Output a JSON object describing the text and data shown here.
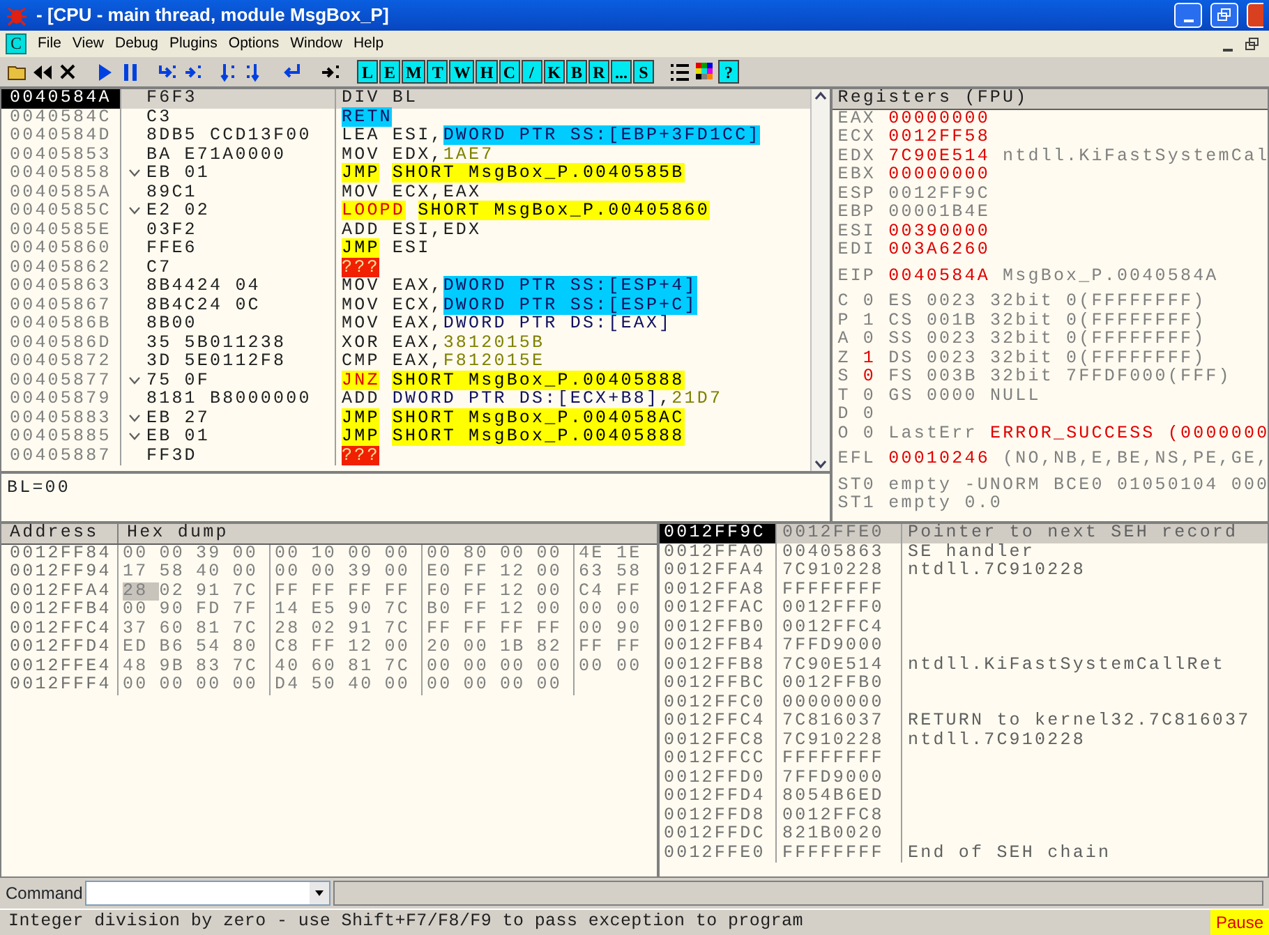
{
  "window": {
    "title": "- [CPU - main thread, module MsgBox_P]"
  },
  "menu": {
    "badge": "C",
    "items": [
      "File",
      "View",
      "Debug",
      "Plugins",
      "Options",
      "Window",
      "Help"
    ]
  },
  "toolbar": {
    "letters": [
      "L",
      "E",
      "M",
      "T",
      "W",
      "H",
      "C",
      "/",
      "K",
      "B",
      "R",
      "...",
      "S"
    ],
    "help": "?"
  },
  "disassembly": {
    "rows": [
      {
        "address": "0040584A",
        "jump": false,
        "hex": "F6F3",
        "mnemonic": {
          "text": "DIV",
          "kind": "op"
        },
        "operands": [
          {
            "text": "BL",
            "kind": "op"
          }
        ],
        "selected": true
      },
      {
        "address": "0040584C",
        "jump": false,
        "hex": "C3",
        "mnemonic": {
          "text": "RETN",
          "kind": "ret"
        },
        "operands": [],
        "selected": false
      },
      {
        "address": "0040584D",
        "jump": false,
        "hex": "8DB5 CCD13F00",
        "mnemonic": {
          "text": "LEA",
          "kind": "op"
        },
        "operands": [
          {
            "text": "ESI,",
            "kind": "op"
          },
          {
            "text": "DWORD PTR SS:[EBP+3FD1CC]",
            "kind": "mem"
          }
        ],
        "selected": false
      },
      {
        "address": "00405853",
        "jump": false,
        "hex": "BA E71A0000",
        "mnemonic": {
          "text": "MOV",
          "kind": "op"
        },
        "operands": [
          {
            "text": "EDX,",
            "kind": "op"
          },
          {
            "text": "1AE7",
            "kind": "imm"
          }
        ],
        "selected": false
      },
      {
        "address": "00405858",
        "jump": true,
        "hex": "EB 01",
        "mnemonic": {
          "text": "JMP",
          "kind": "jmp"
        },
        "operands": [
          {
            "text": "SHORT MsgBox_P.0040585B",
            "kind": "jmp"
          }
        ],
        "selected": false
      },
      {
        "address": "0040585A",
        "jump": false,
        "hex": "89C1",
        "mnemonic": {
          "text": "MOV",
          "kind": "op"
        },
        "operands": [
          {
            "text": "ECX,EAX",
            "kind": "op"
          }
        ],
        "selected": false
      },
      {
        "address": "0040585C",
        "jump": true,
        "hex": "E2 02",
        "mnemonic": {
          "text": "LOOPD",
          "kind": "jcc"
        },
        "operands": [
          {
            "text": "SHORT MsgBox_P.00405860",
            "kind": "jmp"
          }
        ],
        "selected": false
      },
      {
        "address": "0040585E",
        "jump": false,
        "hex": "03F2",
        "mnemonic": {
          "text": "ADD",
          "kind": "op"
        },
        "operands": [
          {
            "text": "ESI,EDX",
            "kind": "op"
          }
        ],
        "selected": false
      },
      {
        "address": "00405860",
        "jump": false,
        "hex": "FFE6",
        "mnemonic": {
          "text": "JMP",
          "kind": "jmp"
        },
        "operands": [
          {
            "text": "ESI",
            "kind": "op"
          }
        ],
        "selected": false
      },
      {
        "address": "00405862",
        "jump": false,
        "hex": "C7",
        "mnemonic": {
          "text": "???",
          "kind": "bad"
        },
        "operands": [],
        "selected": false
      },
      {
        "address": "00405863",
        "jump": false,
        "hex": "8B4424 04",
        "mnemonic": {
          "text": "MOV",
          "kind": "op"
        },
        "operands": [
          {
            "text": "EAX,",
            "kind": "op"
          },
          {
            "text": "DWORD PTR SS:[ESP+4]",
            "kind": "mem"
          }
        ],
        "selected": false
      },
      {
        "address": "00405867",
        "jump": false,
        "hex": "8B4C24 0C",
        "mnemonic": {
          "text": "MOV",
          "kind": "op"
        },
        "operands": [
          {
            "text": "ECX,",
            "kind": "op"
          },
          {
            "text": "DWORD PTR SS:[ESP+C]",
            "kind": "mem"
          }
        ],
        "selected": false
      },
      {
        "address": "0040586B",
        "jump": false,
        "hex": "8B00",
        "mnemonic": {
          "text": "MOV",
          "kind": "op"
        },
        "operands": [
          {
            "text": "EAX,",
            "kind": "op"
          },
          {
            "text": "DWORD PTR DS:[EAX]",
            "kind": "ptr"
          }
        ],
        "selected": false
      },
      {
        "address": "0040586D",
        "jump": false,
        "hex": "35 5B011238",
        "mnemonic": {
          "text": "XOR",
          "kind": "op"
        },
        "operands": [
          {
            "text": "EAX,",
            "kind": "op"
          },
          {
            "text": "3812015B",
            "kind": "imm"
          }
        ],
        "selected": false
      },
      {
        "address": "00405872",
        "jump": false,
        "hex": "3D 5E0112F8",
        "mnemonic": {
          "text": "CMP",
          "kind": "op"
        },
        "operands": [
          {
            "text": "EAX,",
            "kind": "op"
          },
          {
            "text": "F812015E",
            "kind": "imm"
          }
        ],
        "selected": false
      },
      {
        "address": "00405877",
        "jump": true,
        "hex": "75 0F",
        "mnemonic": {
          "text": "JNZ",
          "kind": "jcc"
        },
        "operands": [
          {
            "text": "SHORT MsgBox_P.00405888",
            "kind": "jmp"
          }
        ],
        "selected": false
      },
      {
        "address": "00405879",
        "jump": false,
        "hex": "8181 B8000000",
        "mnemonic": {
          "text": "ADD",
          "kind": "op"
        },
        "operands": [
          {
            "text": "DWORD PTR DS:[ECX+B8]",
            "kind": "ptr"
          },
          {
            "text": ",",
            "kind": "op"
          },
          {
            "text": "21D7",
            "kind": "imm"
          }
        ],
        "selected": false
      },
      {
        "address": "00405883",
        "jump": true,
        "hex": "EB 27",
        "mnemonic": {
          "text": "JMP",
          "kind": "jmp"
        },
        "operands": [
          {
            "text": "SHORT MsgBox_P.004058AC",
            "kind": "jmp"
          }
        ],
        "selected": false
      },
      {
        "address": "00405885",
        "jump": true,
        "hex": "EB 01",
        "mnemonic": {
          "text": "JMP",
          "kind": "jmp"
        },
        "operands": [
          {
            "text": "SHORT MsgBox_P.00405888",
            "kind": "jmp"
          }
        ],
        "selected": false
      },
      {
        "address": "00405887",
        "jump": false,
        "hex": "FF3D",
        "mnemonic": {
          "text": "???",
          "kind": "bad"
        },
        "operands": [],
        "selected": false
      }
    ],
    "info": "BL=00"
  },
  "registers": {
    "title": "Registers (FPU)",
    "general": [
      {
        "name": "EAX",
        "value": "00000000",
        "changed": true
      },
      {
        "name": "ECX",
        "value": "0012FF58",
        "changed": true
      },
      {
        "name": "EDX",
        "value": "7C90E514",
        "changed": true,
        "comment": "ntdll.KiFastSystemCal"
      },
      {
        "name": "EBX",
        "value": "00000000",
        "changed": true
      },
      {
        "name": "ESP",
        "value": "0012FF9C",
        "changed": false
      },
      {
        "name": "EBP",
        "value": "00001B4E",
        "changed": false
      },
      {
        "name": "ESI",
        "value": "00390000",
        "changed": true
      },
      {
        "name": "EDI",
        "value": "003A6260",
        "changed": true
      }
    ],
    "eip": {
      "name": "EIP",
      "value": "0040584A",
      "changed": true,
      "comment": "MsgBox_P.0040584A"
    },
    "flags": [
      {
        "flag": "C",
        "bit": "0",
        "changed": false,
        "detail": "ES 0023 32bit 0(FFFFFFFF)"
      },
      {
        "flag": "P",
        "bit": "1",
        "changed": false,
        "detail": "CS 001B 32bit 0(FFFFFFFF)"
      },
      {
        "flag": "A",
        "bit": "0",
        "changed": false,
        "detail": "SS 0023 32bit 0(FFFFFFFF)"
      },
      {
        "flag": "Z",
        "bit": "1",
        "changed": true,
        "detail": "DS 0023 32bit 0(FFFFFFFF)"
      },
      {
        "flag": "S",
        "bit": "0",
        "changed": true,
        "detail": "FS 003B 32bit 7FFDF000(FFF)"
      },
      {
        "flag": "T",
        "bit": "0",
        "changed": false,
        "detail": "GS 0000 NULL"
      },
      {
        "flag": "D",
        "bit": "0",
        "changed": false
      },
      {
        "flag": "O",
        "bit": "0",
        "changed": false,
        "detail": "LastErr",
        "value": "ERROR_SUCCESS (0000000",
        "value_changed": true
      }
    ],
    "efl": {
      "name": "EFL",
      "value": "00010246",
      "changed": true,
      "comment": "(NO,NB,E,BE,NS,PE,GE,"
    },
    "fpu": [
      {
        "name": "ST0",
        "text": "empty -UNORM BCE0 01050104 000"
      },
      {
        "name": "ST1",
        "text": "empty 0.0"
      }
    ]
  },
  "dump": {
    "columns": [
      "Address",
      "Hex dump"
    ],
    "rows": [
      {
        "address": "0012FF84",
        "bytes": [
          {
            "t": "00",
            "selected": false
          },
          {
            "t": "00",
            "selected": false
          },
          {
            "t": "39",
            "selected": false
          },
          {
            "t": "00",
            "selected": false
          },
          {
            "t": "00",
            "selected": false
          },
          {
            "t": "10",
            "selected": false
          },
          {
            "t": "00",
            "selected": false
          },
          {
            "t": "00",
            "selected": false
          },
          {
            "t": "00",
            "selected": false
          },
          {
            "t": "80",
            "selected": false
          },
          {
            "t": "00",
            "selected": false
          },
          {
            "t": "00",
            "selected": false
          },
          {
            "t": "4E",
            "selected": false
          },
          {
            "t": "1E",
            "selected": false
          }
        ]
      },
      {
        "address": "0012FF94",
        "bytes": [
          {
            "t": "17",
            "selected": false
          },
          {
            "t": "58",
            "selected": false
          },
          {
            "t": "40",
            "selected": false
          },
          {
            "t": "00",
            "selected": false
          },
          {
            "t": "00",
            "selected": false
          },
          {
            "t": "00",
            "selected": false
          },
          {
            "t": "39",
            "selected": false
          },
          {
            "t": "00",
            "selected": false
          },
          {
            "t": "E0",
            "selected": false
          },
          {
            "t": "FF",
            "selected": false
          },
          {
            "t": "12",
            "selected": false
          },
          {
            "t": "00",
            "selected": false
          },
          {
            "t": "63",
            "selected": false
          },
          {
            "t": "58",
            "selected": false
          }
        ]
      },
      {
        "address": "0012FFA4",
        "bytes": [
          {
            "t": "28",
            "selected": true
          },
          {
            "t": "02",
            "selected": false
          },
          {
            "t": "91",
            "selected": false
          },
          {
            "t": "7C",
            "selected": false
          },
          {
            "t": "FF",
            "selected": false
          },
          {
            "t": "FF",
            "selected": false
          },
          {
            "t": "FF",
            "selected": false
          },
          {
            "t": "FF",
            "selected": false
          },
          {
            "t": "F0",
            "selected": false
          },
          {
            "t": "FF",
            "selected": false
          },
          {
            "t": "12",
            "selected": false
          },
          {
            "t": "00",
            "selected": false
          },
          {
            "t": "C4",
            "selected": false
          },
          {
            "t": "FF",
            "selected": false
          }
        ]
      },
      {
        "address": "0012FFB4",
        "bytes": [
          {
            "t": "00",
            "selected": false
          },
          {
            "t": "90",
            "selected": false
          },
          {
            "t": "FD",
            "selected": false
          },
          {
            "t": "7F",
            "selected": false
          },
          {
            "t": "14",
            "selected": false
          },
          {
            "t": "E5",
            "selected": false
          },
          {
            "t": "90",
            "selected": false
          },
          {
            "t": "7C",
            "selected": false
          },
          {
            "t": "B0",
            "selected": false
          },
          {
            "t": "FF",
            "selected": false
          },
          {
            "t": "12",
            "selected": false
          },
          {
            "t": "00",
            "selected": false
          },
          {
            "t": "00",
            "selected": false
          },
          {
            "t": "00",
            "selected": false
          }
        ]
      },
      {
        "address": "0012FFC4",
        "bytes": [
          {
            "t": "37",
            "selected": false
          },
          {
            "t": "60",
            "selected": false
          },
          {
            "t": "81",
            "selected": false
          },
          {
            "t": "7C",
            "selected": false
          },
          {
            "t": "28",
            "selected": false
          },
          {
            "t": "02",
            "selected": false
          },
          {
            "t": "91",
            "selected": false
          },
          {
            "t": "7C",
            "selected": false
          },
          {
            "t": "FF",
            "selected": false
          },
          {
            "t": "FF",
            "selected": false
          },
          {
            "t": "FF",
            "selected": false
          },
          {
            "t": "FF",
            "selected": false
          },
          {
            "t": "00",
            "selected": false
          },
          {
            "t": "90",
            "selected": false
          }
        ]
      },
      {
        "address": "0012FFD4",
        "bytes": [
          {
            "t": "ED",
            "selected": false
          },
          {
            "t": "B6",
            "selected": false
          },
          {
            "t": "54",
            "selected": false
          },
          {
            "t": "80",
            "selected": false
          },
          {
            "t": "C8",
            "selected": false
          },
          {
            "t": "FF",
            "selected": false
          },
          {
            "t": "12",
            "selected": false
          },
          {
            "t": "00",
            "selected": false
          },
          {
            "t": "20",
            "selected": false
          },
          {
            "t": "00",
            "selected": false
          },
          {
            "t": "1B",
            "selected": false
          },
          {
            "t": "82",
            "selected": false
          },
          {
            "t": "FF",
            "selected": false
          },
          {
            "t": "FF",
            "selected": false
          }
        ]
      },
      {
        "address": "0012FFE4",
        "bytes": [
          {
            "t": "48",
            "selected": false
          },
          {
            "t": "9B",
            "selected": false
          },
          {
            "t": "83",
            "selected": false
          },
          {
            "t": "7C",
            "selected": false
          },
          {
            "t": "40",
            "selected": false
          },
          {
            "t": "60",
            "selected": false
          },
          {
            "t": "81",
            "selected": false
          },
          {
            "t": "7C",
            "selected": false
          },
          {
            "t": "00",
            "selected": false
          },
          {
            "t": "00",
            "selected": false
          },
          {
            "t": "00",
            "selected": false
          },
          {
            "t": "00",
            "selected": false
          },
          {
            "t": "00",
            "selected": false
          },
          {
            "t": "00",
            "selected": false
          }
        ]
      },
      {
        "address": "0012FFF4",
        "bytes": [
          {
            "t": "00",
            "selected": false
          },
          {
            "t": "00",
            "selected": false
          },
          {
            "t": "00",
            "selected": false
          },
          {
            "t": "00",
            "selected": false
          },
          {
            "t": "D4",
            "selected": false
          },
          {
            "t": "50",
            "selected": false
          },
          {
            "t": "40",
            "selected": false
          },
          {
            "t": "00",
            "selected": false
          },
          {
            "t": "00",
            "selected": false
          },
          {
            "t": "00",
            "selected": false
          },
          {
            "t": "00",
            "selected": false
          },
          {
            "t": "00",
            "selected": false
          }
        ]
      }
    ]
  },
  "stack": {
    "rows": [
      {
        "address": "0012FF9C",
        "value": "0012FFE0",
        "comment": "Pointer to next SEH record",
        "selected": true
      },
      {
        "address": "0012FFA0",
        "value": "00405863",
        "comment": "SE handler",
        "selected": false
      },
      {
        "address": "0012FFA4",
        "value": "7C910228",
        "comment": "ntdll.7C910228",
        "selected": false
      },
      {
        "address": "0012FFA8",
        "value": "FFFFFFFF",
        "selected": false
      },
      {
        "address": "0012FFAC",
        "value": "0012FFF0",
        "selected": false
      },
      {
        "address": "0012FFB0",
        "value": "0012FFC4",
        "selected": false
      },
      {
        "address": "0012FFB4",
        "value": "7FFD9000",
        "selected": false
      },
      {
        "address": "0012FFB8",
        "value": "7C90E514",
        "comment": "ntdll.KiFastSystemCallRet",
        "selected": false
      },
      {
        "address": "0012FFBC",
        "value": "0012FFB0",
        "selected": false
      },
      {
        "address": "0012FFC0",
        "value": "00000000",
        "selected": false
      },
      {
        "address": "0012FFC4",
        "value": "7C816037",
        "comment": "RETURN to kernel32.7C816037",
        "selected": false
      },
      {
        "address": "0012FFC8",
        "value": "7C910228",
        "comment": "ntdll.7C910228",
        "selected": false
      },
      {
        "address": "0012FFCC",
        "value": "FFFFFFFF",
        "selected": false
      },
      {
        "address": "0012FFD0",
        "value": "7FFD9000",
        "selected": false
      },
      {
        "address": "0012FFD4",
        "value": "8054B6ED",
        "selected": false
      },
      {
        "address": "0012FFD8",
        "value": "0012FFC8",
        "selected": false
      },
      {
        "address": "0012FFDC",
        "value": "821B0020",
        "selected": false
      },
      {
        "address": "0012FFE0",
        "value": "FFFFFFFF",
        "comment": "End of SEH chain",
        "selected": false
      }
    ]
  },
  "command": {
    "label": "Command"
  },
  "status_bar": {
    "message": "Integer division by zero - use Shift+F7/F8/F9 to pass exception to program",
    "state": "Pause"
  }
}
